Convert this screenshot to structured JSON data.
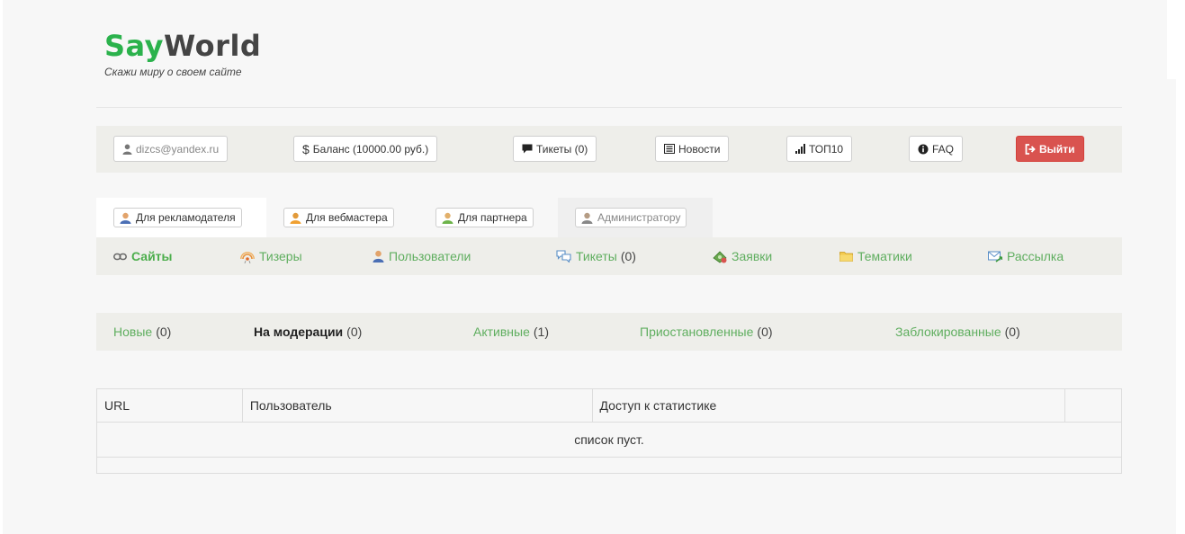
{
  "brand": {
    "logo_say": "Say",
    "logo_world": "World",
    "tagline": "Скажи миру о своем сайте"
  },
  "topbar": {
    "user": "dizcs@yandex.ru",
    "balance": "Баланс (10000.00 руб.)",
    "tickets": "Тикеты (0)",
    "news": "Новости",
    "top10": "ТОП10",
    "faq": "FAQ",
    "logout": "Выйти"
  },
  "roles": {
    "advertiser": "Для рекламодателя",
    "webmaster": "Для вебмастера",
    "partner": "Для партнера",
    "admin": "Администратору"
  },
  "subnav": {
    "sites": "Сайты",
    "teasers": "Тизеры",
    "users": "Пользователи",
    "tickets": "Тикеты",
    "tickets_count": "(0)",
    "requests": "Заявки",
    "topics": "Тематики",
    "mailing": "Рассылка"
  },
  "filters": {
    "new": {
      "label": "Новые",
      "count": "(0)"
    },
    "moderation": {
      "label": "На модерации",
      "count": "(0)"
    },
    "active": {
      "label": "Активные",
      "count": "(1)"
    },
    "paused": {
      "label": "Приостановленные",
      "count": "(0)"
    },
    "blocked": {
      "label": "Заблокированные",
      "count": "(0)"
    }
  },
  "table": {
    "columns": [
      "URL",
      "Пользователь",
      "Доступ к статистике",
      ""
    ],
    "empty_message": "список пуст."
  },
  "colors": {
    "accent_green": "#5fae5f",
    "logo_green": "#2bb24c",
    "danger": "#d9534f"
  }
}
